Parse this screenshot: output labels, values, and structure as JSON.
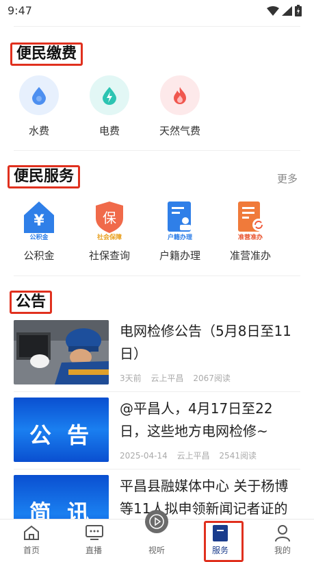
{
  "status": {
    "time": "9:47"
  },
  "section1": {
    "title": "便民缴费",
    "items": [
      {
        "label": "水费",
        "icon": "water-drop-icon",
        "bg": "#e7f0fd",
        "color": "#4d8ff0"
      },
      {
        "label": "电费",
        "icon": "lightning-icon",
        "bg": "#e2f7f5",
        "color": "#2cc4b2"
      },
      {
        "label": "天然气费",
        "icon": "flame-icon",
        "bg": "#fde9ea",
        "color": "#f0574f"
      }
    ]
  },
  "section2": {
    "title": "便民服务",
    "more": "更多",
    "items": [
      {
        "label": "公积金",
        "icon_text": "公积金",
        "glyph": "¥",
        "icon": "housing-fund-icon"
      },
      {
        "label": "社保查询",
        "icon_text": "社会保障",
        "glyph": "保",
        "icon": "social-security-icon"
      },
      {
        "label": "户籍办理",
        "icon_text": "户籍办理",
        "icon": "household-registration-icon"
      },
      {
        "label": "准营准办",
        "icon_text": "准营准办",
        "icon": "business-license-icon"
      }
    ]
  },
  "section3": {
    "title": "公告",
    "news": [
      {
        "title": "电网检修公告（5月8日至11日）",
        "time": "3天前",
        "source": "云上平昌",
        "reads": "2067阅读",
        "thumb": "worker-photo"
      },
      {
        "title": "@平昌人，4月17日至22日，这些地方电网检修~",
        "time": "2025-04-14",
        "source": "云上平昌",
        "reads": "2541阅读",
        "thumb_text": "公 告"
      },
      {
        "title": "平昌县融媒体中心 关于杨博等11人拟申领新闻记者证的",
        "thumb_text": "简 讯"
      }
    ]
  },
  "tabbar": {
    "tabs": [
      {
        "label": "首页",
        "icon": "home-icon"
      },
      {
        "label": "直播",
        "icon": "live-tv-icon"
      },
      {
        "label": "视听",
        "icon": "play-icon"
      },
      {
        "label": "服务",
        "icon": "service-bookmark-icon",
        "active": true
      },
      {
        "label": "我的",
        "icon": "user-icon"
      }
    ],
    "active_color": "#1a3c8c"
  }
}
